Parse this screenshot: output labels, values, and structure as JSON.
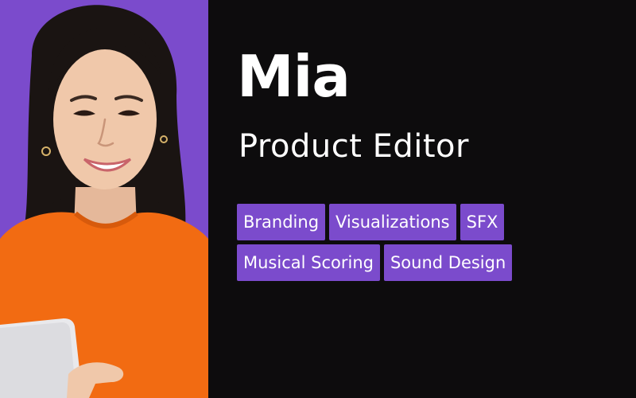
{
  "profile": {
    "name": "Mia",
    "role": "Product Editor"
  },
  "tags": [
    "Branding",
    "Visualizations",
    "SFX",
    "Musical Scoring",
    "Sound Design"
  ],
  "colors": {
    "accent": "#7b4bcc",
    "background": "#0d0c0d",
    "text": "#ffffff",
    "sweater": "#f26b12",
    "hair": "#1a1412"
  },
  "photo": {
    "subject": "smiling woman with dark bob haircut in orange sweater holding a tablet"
  }
}
